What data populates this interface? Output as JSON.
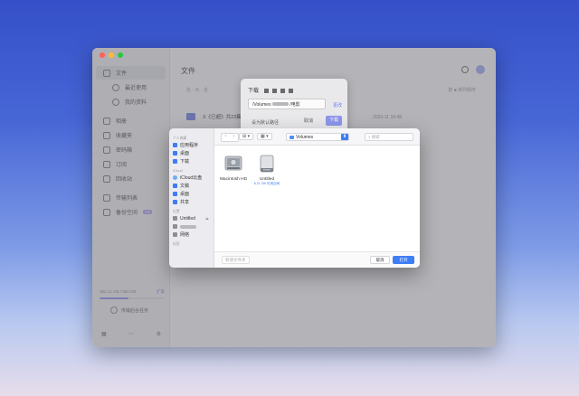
{
  "app": {
    "title": "文件",
    "sidebar": [
      {
        "label": "文件",
        "icon": "file-icon",
        "active": true,
        "sub": false
      },
      {
        "label": "最近使用",
        "icon": "clock-icon",
        "active": false,
        "sub": true
      },
      {
        "label": "我的资料",
        "icon": "profile-icon",
        "active": false,
        "sub": true
      },
      {
        "label": "相册",
        "icon": "album-icon",
        "active": false,
        "sub": false
      },
      {
        "label": "收藏夹",
        "icon": "heart-icon",
        "active": false,
        "sub": false
      },
      {
        "label": "密码箱",
        "icon": "lock-icon",
        "active": false,
        "sub": false
      },
      {
        "label": "订阅",
        "icon": "bookmark-icon",
        "active": false,
        "sub": false
      },
      {
        "label": "回收站",
        "icon": "trash-icon",
        "active": false,
        "sub": false
      },
      {
        "label": "传输列表",
        "icon": "transfer-icon",
        "active": false,
        "sub": false
      },
      {
        "label": "备份空间",
        "icon": "backup-icon",
        "active": false,
        "sub": false
      }
    ],
    "vip_badge": "VIP",
    "storage_text": "382.12 GB / 850 GB",
    "storage_fraction": 0.45,
    "expand_label": "扩容",
    "transfer_label": "传输后台任务",
    "column_name": "名 · 大 · 全",
    "column_sort": "按 ■ 排列顺序",
    "file_name": "X《已超》共23集",
    "file_time": "2020-11 16:48"
  },
  "download_dialog": {
    "title": "下载",
    "path": "/Volumes",
    "path_suffix": "/电影",
    "change_label": "更改",
    "default_label": "设为默认路径",
    "cancel_label": "取消",
    "confirm_label": "下载"
  },
  "file_picker": {
    "sections": {
      "personal": "个人收藏",
      "icloud": "iCloud",
      "locations": "位置",
      "tags": "标签"
    },
    "favorites": [
      {
        "label": "应用程序",
        "icon": "applications-icon"
      },
      {
        "label": "桌面",
        "icon": "desktop-icon"
      },
      {
        "label": "下载",
        "icon": "downloads-icon"
      }
    ],
    "icloud_items": [
      {
        "label": "iCloud云盘",
        "icon": "icloud-icon"
      },
      {
        "label": "文稿",
        "icon": "document-icon"
      },
      {
        "label": "桌面",
        "icon": "desktop-icon"
      },
      {
        "label": "共享",
        "icon": "shared-folder-icon"
      }
    ],
    "locations": [
      {
        "label": "Untitled",
        "icon": "external-drive-icon",
        "eject": "⏏"
      },
      {
        "label": "",
        "icon": "computer-icon"
      },
      {
        "label": "网络",
        "icon": "network-icon"
      }
    ],
    "toolbar": {
      "back": "‹",
      "forward": "›",
      "icon_view": "⊞ ▾",
      "group_view": "▦ ▾",
      "location": "Volumes",
      "location_chevron": "⬍",
      "search_placeholder": "搜索"
    },
    "volumes": [
      {
        "label": "Macintosh HD",
        "sub": ""
      },
      {
        "label": "Untitled",
        "sub": "6.21 GB 可用空间"
      }
    ],
    "footer": {
      "new_folder": "新建文件夹",
      "cancel": "取消",
      "open": "打开"
    }
  },
  "colors": {
    "accent": "#3d7df5",
    "app_accent": "#8d95ee"
  }
}
